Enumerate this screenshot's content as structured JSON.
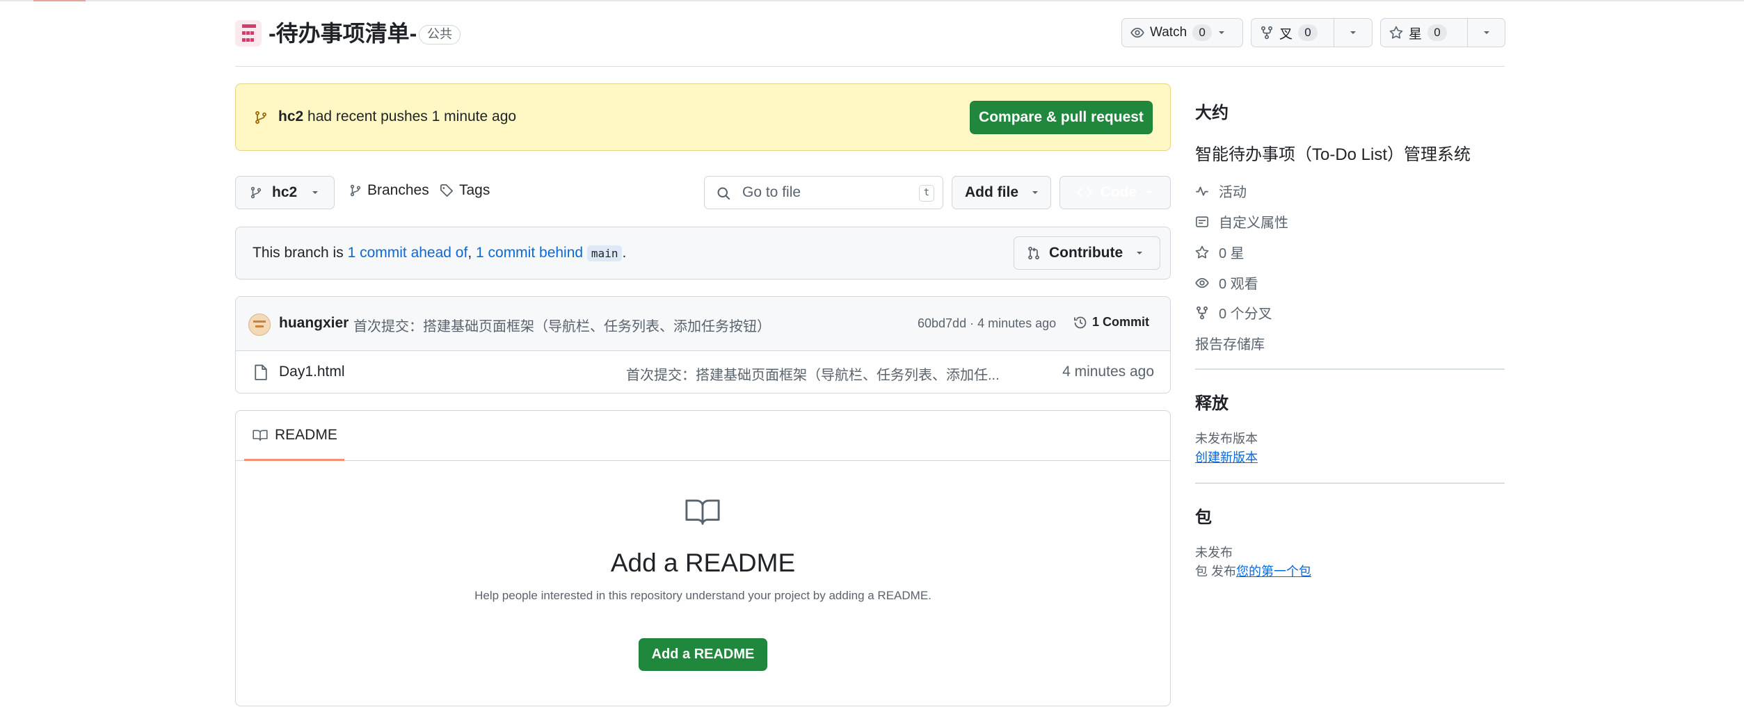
{
  "repo": {
    "name": "-待办事项清单-",
    "visibility": "公共"
  },
  "header_actions": {
    "watch_label": "Watch",
    "watch_count": "0",
    "fork_label": "叉",
    "fork_count": "0",
    "star_label": "星",
    "star_count": "0"
  },
  "banner": {
    "branch": "hc2",
    "message": " had recent pushes 1 minute ago",
    "button": "Compare & pull request"
  },
  "toolbar": {
    "branch": "hc2",
    "branches_label": "Branches",
    "tags_label": "Tags",
    "search_placeholder": "Go to file",
    "search_shortcut": "t",
    "add_file_label": "Add file",
    "code_label": "Code"
  },
  "branch_info": {
    "prefix": "This branch is ",
    "ahead": "1 commit ahead of",
    "sep": ", ",
    "behind": "1 commit behind",
    "base": "main",
    "suffix": ".",
    "contribute_label": "Contribute"
  },
  "latest_commit": {
    "author": "huangxier",
    "message": "首次提交：搭建基础页面框架（导航栏、任务列表、添加任务按钮）",
    "hash_age": "60bd7dd · 4 minutes ago",
    "commit_count": "1 Commit"
  },
  "files": [
    {
      "name": "Day1.html",
      "message": "首次提交：搭建基础页面框架（导航栏、任务列表、添加任...",
      "age": "4 minutes ago"
    }
  ],
  "readme": {
    "tab_label": "README",
    "title": "Add a README",
    "help": "Help people interested in this repository understand your project by adding a README.",
    "button": "Add a README"
  },
  "sidebar": {
    "about_heading": "大约",
    "description": "智能待办事项（To-Do List）管理系统",
    "activity": "活动",
    "custom_props": "自定义属性",
    "stars": "0 星",
    "watchers": "0 观看",
    "forks": "0 个分叉",
    "report": "报告存储库",
    "releases_heading": "释放",
    "no_releases": "未发布版本",
    "create_release": "创建新版本",
    "packages_heading": "包",
    "no_packages": "未发布",
    "packages_prefix": "包 发布",
    "first_package": "您的第一个包"
  }
}
